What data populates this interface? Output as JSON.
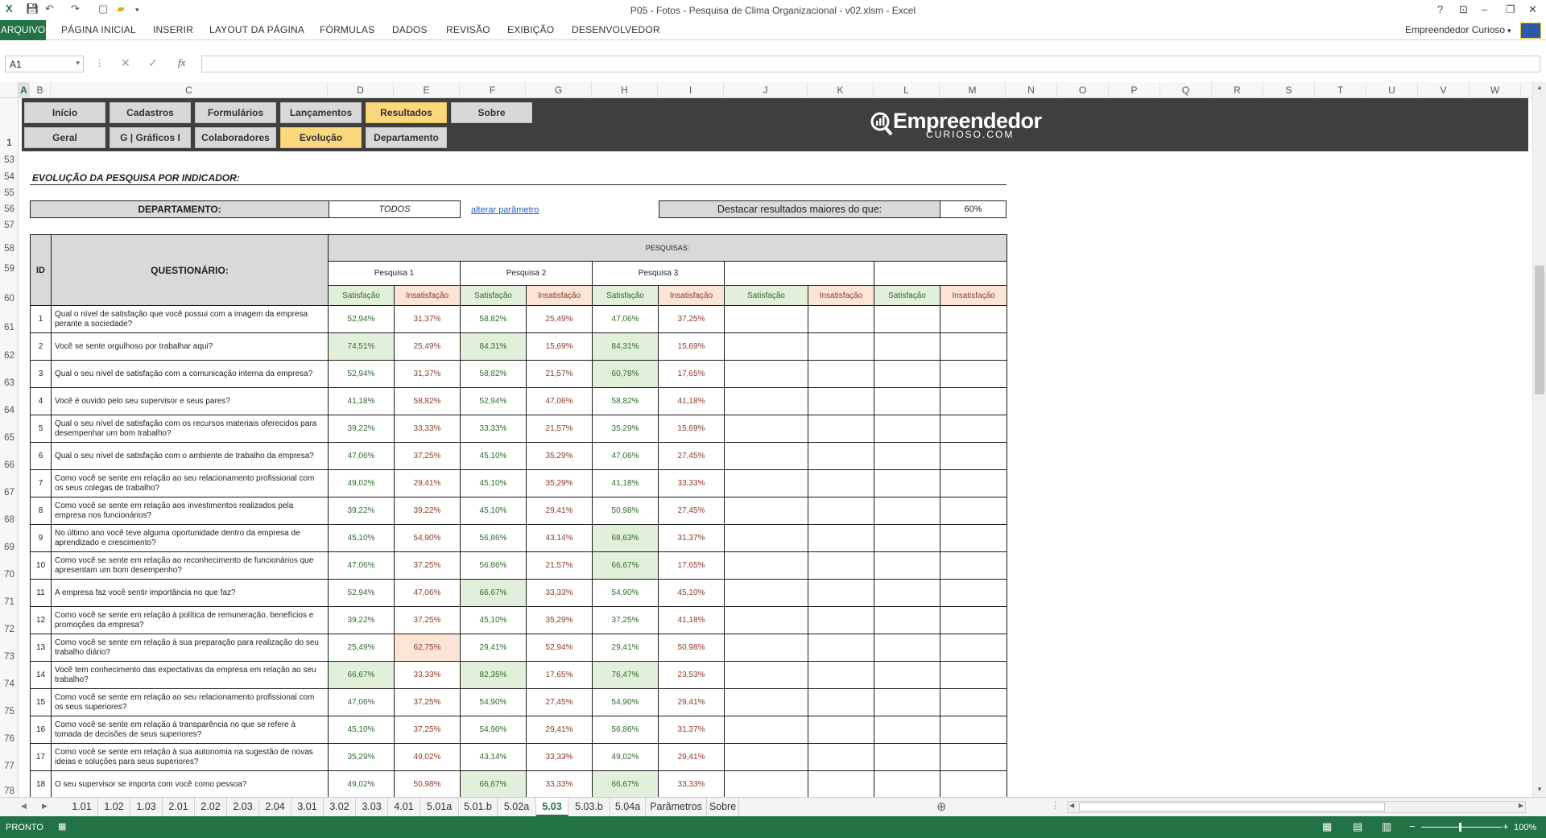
{
  "window": {
    "title": "P05 - Fotos - Pesquisa de Clima Organizacional - v02.xlsm - Excel",
    "help": "?",
    "minimize": "–",
    "restore": "❐",
    "close": "✕"
  },
  "ribbon": {
    "tabs": [
      "ARQUIVO",
      "PÁGINA INICIAL",
      "INSERIR",
      "LAYOUT DA PÁGINA",
      "FÓRMULAS",
      "DADOS",
      "REVISÃO",
      "EXIBIÇÃO",
      "DESENVOLVEDOR"
    ],
    "user": "Empreendedor Curioso"
  },
  "formula_bar": {
    "name_box": "A1",
    "fx": "fx",
    "value": ""
  },
  "columns": [
    "A",
    "B",
    "C",
    "D",
    "E",
    "F",
    "G",
    "H",
    "I",
    "J",
    "K",
    "L",
    "M",
    "N",
    "O",
    "P",
    "Q",
    "R",
    "S",
    "T",
    "U",
    "V",
    "W"
  ],
  "rows": [
    "1",
    "53",
    "54",
    "55",
    "56",
    "57",
    "58",
    "59",
    "60",
    "61",
    "62",
    "63",
    "64",
    "65",
    "66",
    "67",
    "68",
    "69",
    "70",
    "71",
    "72",
    "73",
    "74",
    "75",
    "76",
    "77",
    "78"
  ],
  "nav": {
    "top": [
      "Início",
      "Cadastros",
      "Formulários",
      "Lançamentos",
      "Resultados",
      "Sobre"
    ],
    "bottom": [
      "Geral",
      "G | Gráficos I",
      "Colaboradores",
      "Evolução",
      "Departamento"
    ],
    "active_top": "Resultados",
    "active_bottom": "Evolução"
  },
  "logo": {
    "line1": "Empreendedor",
    "line2": "CURIOSO.COM"
  },
  "section_title": "EVOLUÇÃO DA PESQUISA POR INDICADOR:",
  "filter": {
    "label": "DEPARTAMENTO:",
    "value": "TODOS",
    "link": "alterar parâmetro",
    "highlight_label": "Destacar resultados maiores do que:",
    "highlight_value": "60%"
  },
  "table": {
    "id_header": "ID",
    "question_header": "QUESTIONÁRIO:",
    "surveys_header": "PESQUISAS:",
    "surveys": [
      "Pesquisa 1",
      "Pesquisa 2",
      "Pesquisa 3",
      "",
      ""
    ],
    "sat_label": "Satisfação",
    "insat_label": "Insatisfação",
    "rows": [
      {
        "id": "1",
        "q": "Qual o nível de satisfação que você possui com a imagem da empresa perante a sociedade?",
        "v": [
          "52,94%",
          "31,37%",
          "58,82%",
          "25,49%",
          "47,06%",
          "37,25%"
        ]
      },
      {
        "id": "2",
        "q": "Você se sente orgulhoso por trabalhar aqui?",
        "v": [
          "74,51%",
          "25,49%",
          "84,31%",
          "15,69%",
          "84,31%",
          "15,69%"
        ]
      },
      {
        "id": "3",
        "q": "Qual o seu nível de satisfação com a comunicação interna da empresa?",
        "v": [
          "52,94%",
          "31,37%",
          "58,82%",
          "21,57%",
          "60,78%",
          "17,65%"
        ]
      },
      {
        "id": "4",
        "q": "Você é ouvido pelo seu supervisor e seus pares?",
        "v": [
          "41,18%",
          "58,82%",
          "52,94%",
          "47,06%",
          "58,82%",
          "41,18%"
        ]
      },
      {
        "id": "5",
        "q": "Qual o seu nível de satisfação com os recursos materiais oferecidos para desempenhar um bom trabalho?",
        "v": [
          "39,22%",
          "33,33%",
          "33,33%",
          "21,57%",
          "35,29%",
          "15,69%"
        ]
      },
      {
        "id": "6",
        "q": "Qual o seu nível de satisfação com o ambiente de trabalho da empresa?",
        "v": [
          "47,06%",
          "37,25%",
          "45,10%",
          "35,29%",
          "47,06%",
          "27,45%"
        ]
      },
      {
        "id": "7",
        "q": "Como você se sente em relação ao seu relacionamento profissional com os seus colegas de trabalho?",
        "v": [
          "49,02%",
          "29,41%",
          "45,10%",
          "35,29%",
          "41,18%",
          "33,33%"
        ]
      },
      {
        "id": "8",
        "q": "Como você se sente em relação aos investimentos realizados pela empresa nos funcionários?",
        "v": [
          "39,22%",
          "39,22%",
          "45,10%",
          "29,41%",
          "50,98%",
          "27,45%"
        ]
      },
      {
        "id": "9",
        "q": "No último ano você teve alguma oportunidade dentro da empresa de aprendizado e crescimento?",
        "v": [
          "45,10%",
          "54,90%",
          "56,86%",
          "43,14%",
          "68,63%",
          "31,37%"
        ]
      },
      {
        "id": "10",
        "q": "Como você se sente em relação ao reconhecimento de funcionários que apresentam um bom desempenho?",
        "v": [
          "47,06%",
          "37,25%",
          "56,86%",
          "21,57%",
          "66,67%",
          "17,65%"
        ]
      },
      {
        "id": "11",
        "q": "A empresa faz você sentir importância no que faz?",
        "v": [
          "52,94%",
          "47,06%",
          "66,67%",
          "33,33%",
          "54,90%",
          "45,10%"
        ]
      },
      {
        "id": "12",
        "q": "Como você se sente em relação à política de remuneração, benefícios e promoções da empresa?",
        "v": [
          "39,22%",
          "37,25%",
          "45,10%",
          "35,29%",
          "37,25%",
          "41,18%"
        ]
      },
      {
        "id": "13",
        "q": "Como você se sente em relação à  sua preparação para realização do seu trabalho diário?",
        "v": [
          "25,49%",
          "62,75%",
          "29,41%",
          "52,94%",
          "29,41%",
          "50,98%"
        ]
      },
      {
        "id": "14",
        "q": "Você tem conhecimento das expectativas da empresa em relação ao seu trabalho?",
        "v": [
          "66,67%",
          "33,33%",
          "82,35%",
          "17,65%",
          "76,47%",
          "23,53%"
        ]
      },
      {
        "id": "15",
        "q": "Como você se sente em relação ao seu relacionamento profissional com os seus superiores?",
        "v": [
          "47,06%",
          "37,25%",
          "54,90%",
          "27,45%",
          "54,90%",
          "29,41%"
        ]
      },
      {
        "id": "16",
        "q": "Como você se sente em relação à transparência no que se refere à tomada de decisões de seus superiores?",
        "v": [
          "45,10%",
          "37,25%",
          "54,90%",
          "29,41%",
          "56,86%",
          "31,37%"
        ]
      },
      {
        "id": "17",
        "q": "Como você se sente em relação à sua autonomia na sugestão de novas ideias e soluções para seus superiores?",
        "v": [
          "35,29%",
          "49,02%",
          "43,14%",
          "33,33%",
          "49,02%",
          "29,41%"
        ]
      },
      {
        "id": "18",
        "q": "O seu supervisor se importa com você como pessoa?",
        "v": [
          "49,02%",
          "50,98%",
          "66,67%",
          "33,33%",
          "66,67%",
          "33,33%"
        ]
      }
    ]
  },
  "sheets": [
    "1.01",
    "1.02",
    "1.03",
    "2.01",
    "2.02",
    "2.03",
    "2.04",
    "3.01",
    "3.02",
    "3.03",
    "4.01",
    "5.01a",
    "5.01.b",
    "5.02a",
    "5.03",
    "5.03.b",
    "5.04a",
    "Parâmetros",
    "Sobre"
  ],
  "active_sheet": "5.03",
  "status": {
    "ready": "PRONTO",
    "zoom": "100%"
  },
  "colors": {
    "excel_green": "#217346",
    "nav_active": "#fbd77d",
    "sat_highlight": "#e2efda",
    "insat_highlight": "#fce4d6"
  }
}
